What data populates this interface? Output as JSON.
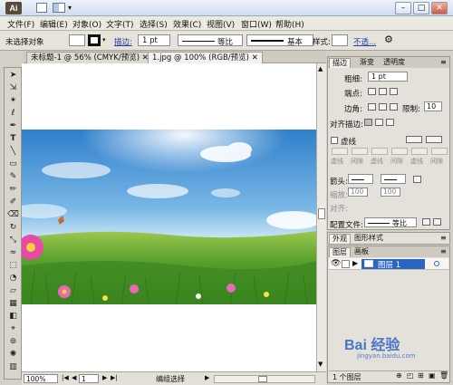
{
  "app": {
    "logo": "Ai",
    "title_icon_names": [
      "layout-icon",
      "arrange-icon"
    ]
  },
  "menus": [
    "文件(F)",
    "编辑(E)",
    "对象(O)",
    "文字(T)",
    "选择(S)",
    "效果(C)",
    "视图(V)",
    "窗口(W)",
    "帮助(H)"
  ],
  "control_bar": {
    "selection_status": "未选择对象",
    "stroke_label": "描边:",
    "stroke_weight": "1 pt",
    "profile_label": "等比",
    "brush_label": "基本",
    "style_label": "样式:",
    "opacity_label": "不透..."
  },
  "document_tabs": [
    {
      "label": "未标题-1 @ 56% (CMYK/预览)",
      "active": false
    },
    {
      "label": "1.jpg @ 100% (RGB/预览)",
      "active": true
    }
  ],
  "stroke_panel": {
    "tabs": [
      "描边",
      "渐变",
      "透明度"
    ],
    "weight_label": "粗细:",
    "weight_value": "1 pt",
    "cap_label": "端点:",
    "corner_label": "边角:",
    "limit_label": "限制:",
    "limit_value": "10",
    "align_label": "对齐描边:",
    "dashed_label": "虚线",
    "dash_fields": [
      "虚线",
      "间隙",
      "虚线",
      "间隙",
      "虚线",
      "间隙"
    ],
    "arrow_label": "箭头:",
    "scale_label": "缩放:",
    "scale_values": [
      "100",
      "100"
    ],
    "align2_label": "对齐:",
    "profile_label": "配置文件:",
    "profile_value": "等比"
  },
  "appearance_panel": {
    "tabs": [
      "外观",
      "图形样式"
    ]
  },
  "layers_panel": {
    "tabs": [
      "图层",
      "画板"
    ],
    "layer_name": "图层 1",
    "layer_count": "1 个图层"
  },
  "statusbar": {
    "zoom": "100%",
    "page": "1",
    "mode": "编组选择"
  },
  "watermark": {
    "text": "Bai 经验",
    "sub": "jingyan.baidu.com"
  },
  "colors": {
    "accent_blue": "#2c64c4",
    "sky_top": "#3d8fd6",
    "grass": "#4f9a27"
  }
}
